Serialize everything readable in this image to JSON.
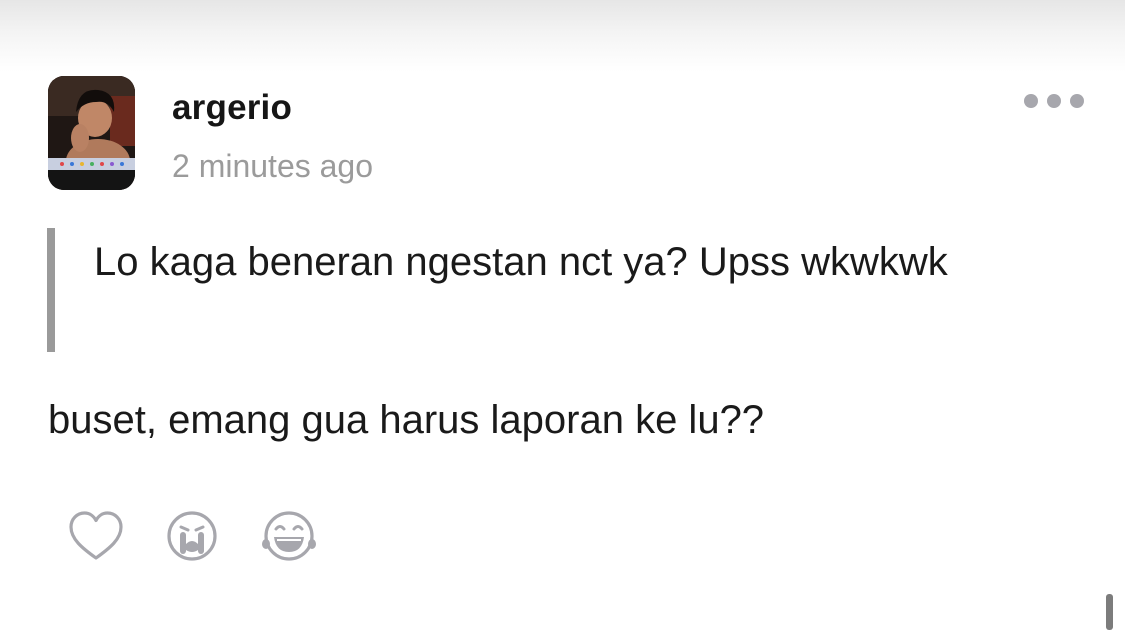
{
  "post": {
    "username": "argerio",
    "timestamp": "2 minutes ago",
    "quoted_text": "Lo kaga beneran ngestan nct ya? Upss wkwkwk",
    "reply_text": "buset, emang gua harus laporan ke lu??"
  },
  "icons": {
    "more": "more-dots-icon",
    "like": "heart-icon",
    "cry": "crying-face-icon",
    "laugh": "laughing-face-icon"
  },
  "colors": {
    "text": "#1a1a1a",
    "muted": "#9b9b9b",
    "icon": "#a7a7ad",
    "quote_bar": "#9a9a9a"
  }
}
